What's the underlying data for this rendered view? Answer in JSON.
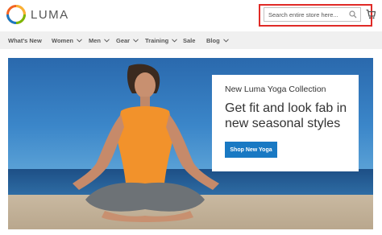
{
  "brand": {
    "name": "LUMA"
  },
  "search": {
    "placeholder": "Search entire store here..."
  },
  "nav": {
    "items": [
      {
        "label": "What's New",
        "dropdown": false
      },
      {
        "label": "Women",
        "dropdown": true
      },
      {
        "label": "Men",
        "dropdown": true
      },
      {
        "label": "Gear",
        "dropdown": true
      },
      {
        "label": "Training",
        "dropdown": true
      },
      {
        "label": "Sale",
        "dropdown": false
      },
      {
        "label": "Blog",
        "dropdown": true
      }
    ]
  },
  "hero": {
    "subtitle": "New Luma Yoga Collection",
    "title": "Get fit and look fab in new seasonal styles",
    "button_label": "Shop New Yoga"
  },
  "icons": {
    "logo": "luma-logo-icon",
    "search": "search-icon",
    "cart": "cart-icon",
    "dropdown": "chevron-down-icon"
  },
  "colors": {
    "primary_button": "#1979c3",
    "highlight": "#e02b27",
    "nav_bg": "#f0f0f0"
  }
}
